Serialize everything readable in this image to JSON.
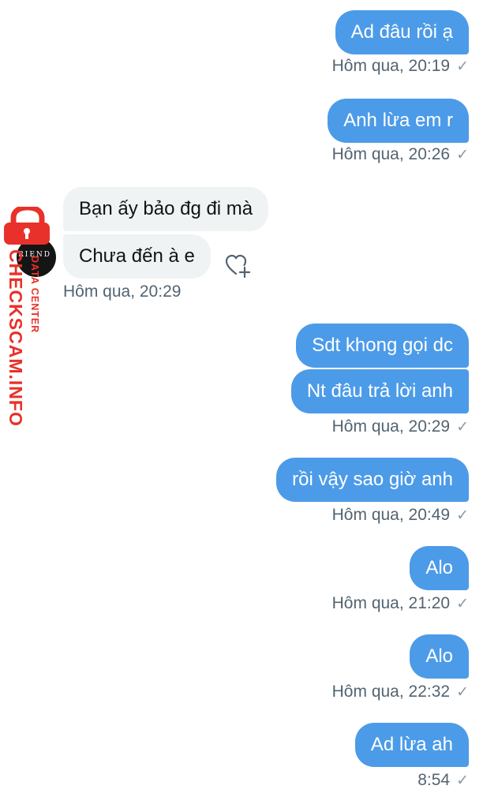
{
  "messages": [
    {
      "text": "Ad đâu rồi ạ",
      "meta": "Hôm qua, 20:19"
    },
    {
      "text": "Anh lừa em r",
      "meta": "Hôm qua, 20:26"
    },
    {
      "text": "Bạn ấy bảo đg đi mà"
    },
    {
      "text": "Chưa đến à e",
      "meta": "Hôm qua, 20:29"
    },
    {
      "text": "Sdt khong gọi dc"
    },
    {
      "text": "Nt đâu trả lời anh",
      "meta": "Hôm qua, 20:29"
    },
    {
      "text": "rồi vậy sao giờ anh",
      "meta": "Hôm qua, 20:49"
    },
    {
      "text": "Alo",
      "meta": "Hôm qua, 21:20"
    },
    {
      "text": "Alo",
      "meta": "Hôm qua, 22:32"
    },
    {
      "text": "Ad lừa ah",
      "meta": "8:54"
    }
  ],
  "icons": {
    "read_check": "✓",
    "like": "heart-plus-icon",
    "avatar": "avatar"
  },
  "watermark": {
    "site": "CHECKSCAM.INFO",
    "sub": "DATA CENTER",
    "avatar_text": "RIEND",
    "color": "#e8312a"
  },
  "colors": {
    "outgoing": "#4c9be8",
    "incoming": "#eff3f4"
  }
}
